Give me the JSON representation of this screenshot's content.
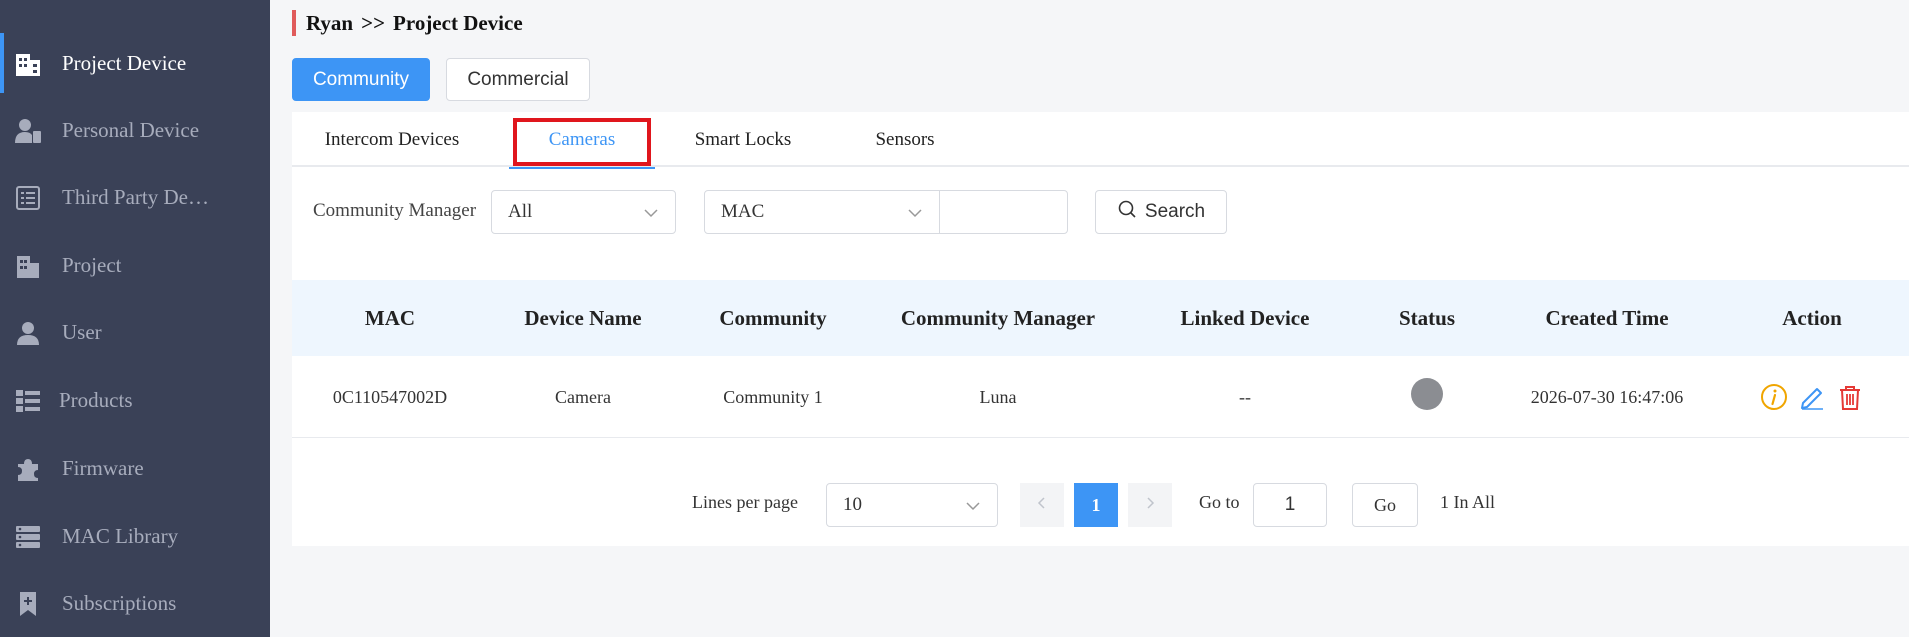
{
  "sidebar": {
    "items": [
      {
        "label": "Project Device",
        "icon": "building-device-icon",
        "active": true
      },
      {
        "label": "Personal Device",
        "icon": "person-device-icon"
      },
      {
        "label": "Third Party De…",
        "icon": "list-document-icon"
      },
      {
        "label": "Project",
        "icon": "building-icon"
      },
      {
        "label": "User",
        "icon": "user-icon"
      },
      {
        "label": "Products",
        "icon": "products-grid-icon"
      },
      {
        "label": "Firmware",
        "icon": "puzzle-icon"
      },
      {
        "label": "MAC Library",
        "icon": "server-icon"
      },
      {
        "label": "Subscriptions",
        "icon": "bookmark-plus-icon"
      }
    ]
  },
  "breadcrumb": {
    "root": "Ryan",
    "separator": ">>",
    "current": "Project Device"
  },
  "segments": {
    "community": "Community",
    "commercial": "Commercial"
  },
  "tabs": [
    {
      "label": "Intercom Devices"
    },
    {
      "label": "Cameras",
      "active": true
    },
    {
      "label": "Smart Locks"
    },
    {
      "label": "Sensors"
    }
  ],
  "filters": {
    "manager_label": "Community Manager",
    "manager_value": "All",
    "field_value": "MAC",
    "search_value": "",
    "search_button": "Search"
  },
  "table": {
    "headers": [
      "MAC",
      "Device Name",
      "Community",
      "Community Manager",
      "Linked Device",
      "Status",
      "Created Time",
      "Action"
    ],
    "rows": [
      {
        "mac": "0C110547002D",
        "device_name": "Camera",
        "community": "Community 1",
        "manager": "Luna",
        "linked": "--",
        "status": "offline",
        "created": "2026-07-30 16:47:06"
      }
    ]
  },
  "pagination": {
    "lines_label": "Lines per page",
    "lines_value": "10",
    "current_page": "1",
    "goto_label": "Go to",
    "goto_value": "1",
    "go_button": "Go",
    "total": "1 In All"
  },
  "colors": {
    "primary": "#3d95f5",
    "sidebar": "#3a4157",
    "highlight": "#e0161d",
    "info": "#f0a500",
    "danger": "#e53935"
  }
}
